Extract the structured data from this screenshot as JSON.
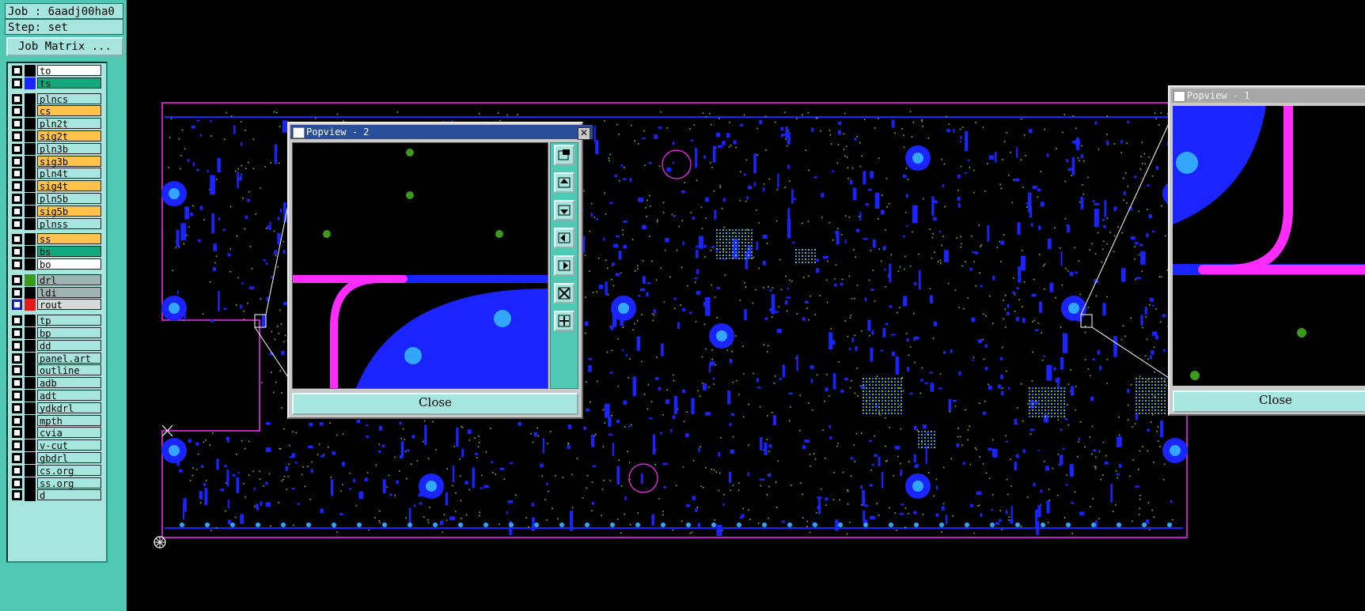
{
  "info": {
    "job": "Job : 6aadj00ha0",
    "step": "Step: set",
    "job_matrix_label": "Job Matrix ..."
  },
  "layers": [
    {
      "name": "to",
      "bg": "#ffffff",
      "swatch": "#000000",
      "checked": false
    },
    {
      "name": "ts",
      "bg": "#14a87f",
      "swatch": "#1a24ff",
      "checked": false
    },
    {
      "name": "plncs",
      "bg": "#a6e6de",
      "swatch": "#000000",
      "checked": false
    },
    {
      "name": "cs",
      "bg": "#ffc24a",
      "swatch": "#000000",
      "checked": false
    },
    {
      "name": "pln2t",
      "bg": "#a6e6de",
      "swatch": "#000000",
      "checked": false
    },
    {
      "name": "sig2t",
      "bg": "#ffc24a",
      "swatch": "#000000",
      "checked": false
    },
    {
      "name": "pln3b",
      "bg": "#a6e6de",
      "swatch": "#000000",
      "checked": false
    },
    {
      "name": "sig3b",
      "bg": "#ffc24a",
      "swatch": "#000000",
      "checked": false
    },
    {
      "name": "pln4t",
      "bg": "#a6e6de",
      "swatch": "#000000",
      "checked": false
    },
    {
      "name": "sig4t",
      "bg": "#ffc24a",
      "swatch": "#000000",
      "checked": false
    },
    {
      "name": "pln5b",
      "bg": "#a6e6de",
      "swatch": "#000000",
      "checked": false
    },
    {
      "name": "sig5b",
      "bg": "#ffc24a",
      "swatch": "#000000",
      "checked": false
    },
    {
      "name": "plnss",
      "bg": "#a6e6de",
      "swatch": "#000000",
      "checked": false
    },
    {
      "name": "ss",
      "bg": "#ffc24a",
      "swatch": "#000000",
      "checked": false
    },
    {
      "name": "bs",
      "bg": "#14a87f",
      "swatch": "#000000",
      "checked": false
    },
    {
      "name": "bo",
      "bg": "#ffffff",
      "swatch": "#000000",
      "checked": false
    },
    {
      "name": "drl",
      "bg": "#9fb3b3",
      "swatch": "#3c9a1a",
      "checked": false
    },
    {
      "name": "ldi",
      "bg": "#9fb3b3",
      "swatch": "#000000",
      "checked": false
    },
    {
      "name": "rout",
      "bg": "#d9d9d9",
      "swatch": "#e11b1b",
      "checked": true
    },
    {
      "name": "tp",
      "bg": "#a6e6de",
      "swatch": "#000000",
      "checked": false
    },
    {
      "name": "bp",
      "bg": "#a6e6de",
      "swatch": "#000000",
      "checked": false
    },
    {
      "name": "dd",
      "bg": "#a6e6de",
      "swatch": "#000000",
      "checked": false
    },
    {
      "name": "panel.art",
      "bg": "#a6e6de",
      "swatch": "#000000",
      "checked": false
    },
    {
      "name": "outline",
      "bg": "#a6e6de",
      "swatch": "#000000",
      "checked": false
    },
    {
      "name": "adb",
      "bg": "#a6e6de",
      "swatch": "#000000",
      "checked": false
    },
    {
      "name": "adt",
      "bg": "#a6e6de",
      "swatch": "#000000",
      "checked": false
    },
    {
      "name": "ydkdrl",
      "bg": "#a6e6de",
      "swatch": "#000000",
      "checked": false
    },
    {
      "name": "mpth",
      "bg": "#a6e6de",
      "swatch": "#000000",
      "checked": false
    },
    {
      "name": "cvia",
      "bg": "#a6e6de",
      "swatch": "#000000",
      "checked": false
    },
    {
      "name": "v-cut",
      "bg": "#a6e6de",
      "swatch": "#000000",
      "checked": false
    },
    {
      "name": "gbdrl",
      "bg": "#a6e6de",
      "swatch": "#000000",
      "checked": false
    },
    {
      "name": "cs.org",
      "bg": "#a6e6de",
      "swatch": "#000000",
      "checked": false
    },
    {
      "name": "ss.org",
      "bg": "#a6e6de",
      "swatch": "#000000",
      "checked": false
    },
    {
      "name": "d",
      "bg": "#a6e6de",
      "swatch": "#000000",
      "checked": false
    }
  ],
  "popview2": {
    "title": "Popview - 2",
    "close_label": "Close"
  },
  "popview1": {
    "title": "Popview - 1",
    "close_label": "Close"
  },
  "colors": {
    "board_blue": "#1a24ff",
    "pad_light": "#33a6ff",
    "rout_magenta": "#ff2bff",
    "drill_green": "#3c9a1a",
    "panel_bg": "#4fc9b4",
    "popup_title": "#2a4f9a"
  }
}
